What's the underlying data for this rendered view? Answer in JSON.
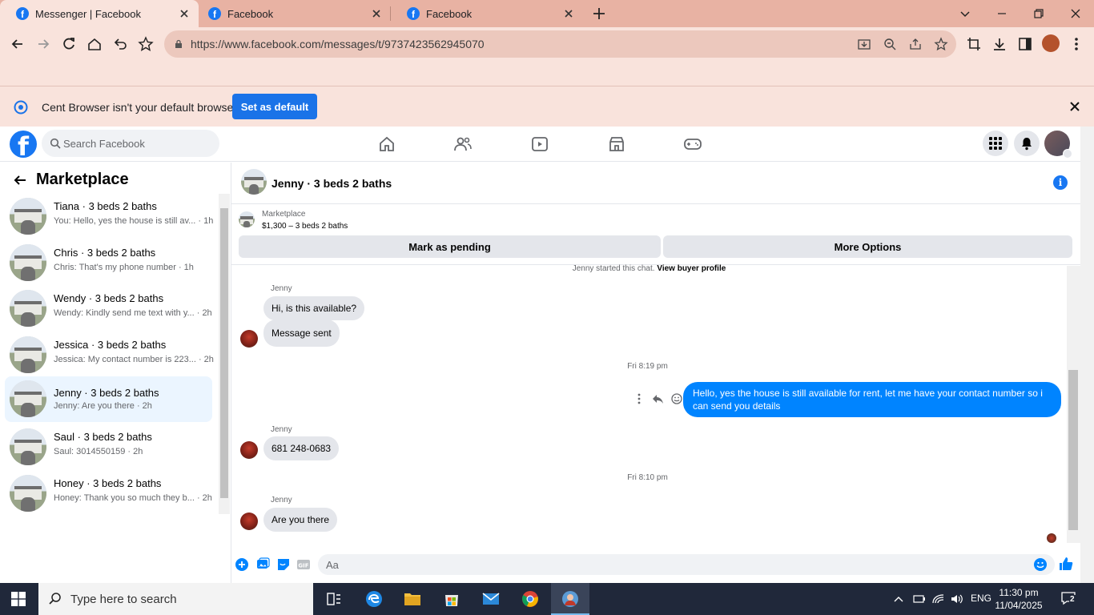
{
  "browser": {
    "tabs": [
      {
        "title": "Messenger | Facebook",
        "active": true
      },
      {
        "title": "Facebook",
        "active": false
      },
      {
        "title": "Facebook",
        "active": false
      }
    ],
    "url": "https://www.facebook.com/messages/t/9737423562945070",
    "infobar": {
      "message": "Cent Browser isn't your default browser",
      "button": "Set as default"
    }
  },
  "facebook": {
    "search_placeholder": "Search Facebook",
    "sidebar": {
      "title": "Marketplace",
      "conversations": [
        {
          "name": "Tiana · 3 beds 2 baths",
          "snippet": "You: Hello, yes the house is still av... · 1h"
        },
        {
          "name": "Chris · 3 beds 2 baths",
          "snippet": "Chris: That's my phone number · 1h"
        },
        {
          "name": "Wendy · 3 beds 2 baths",
          "snippet": "Wendy: Kindly send me text with y... · 2h"
        },
        {
          "name": "Jessica · 3 beds 2 baths",
          "snippet": "Jessica: My contact number is 223... · 2h"
        },
        {
          "name": "Jenny · 3 beds 2 baths",
          "snippet": "Jenny: Are you there · 2h",
          "active": true
        },
        {
          "name": "Saul · 3 beds 2 baths",
          "snippet": "Saul: 3014550159 · 2h"
        },
        {
          "name": "Honey · 3 beds 2 baths",
          "snippet": "Honey: Thank you so much they b... · 2h"
        }
      ]
    },
    "chat": {
      "title": "Jenny · 3 beds 2 baths",
      "listing_label": "Marketplace",
      "listing_price": "$1,300 – 3 beds 2 baths",
      "mark_pending": "Mark as pending",
      "more_options": "More Options",
      "system_line": "Jenny started this chat.",
      "system_link": "View buyer profile",
      "sender": "Jenny",
      "msg1": "Hi, is this available?",
      "msg2": "Message sent",
      "time1": "Fri 8:19 pm",
      "my_msg": "Hello, yes the house is still available for rent, let me have your contact number so i can send you details",
      "msg3": "681 248-0683",
      "time2": "Fri 8:10 pm",
      "msg4": "Are you there",
      "composer_placeholder": "Aa"
    }
  },
  "taskbar": {
    "search_placeholder": "Type here to search",
    "lang": "ENG",
    "time": "11:30 pm",
    "date": "11/04/2025",
    "notifications": "2"
  },
  "colors": {
    "fb_blue": "#1877f2",
    "my_bubble": "#0084ff",
    "chrome_tab": "#e8b2a3",
    "chrome_toolbar": "#f9e3dc"
  }
}
